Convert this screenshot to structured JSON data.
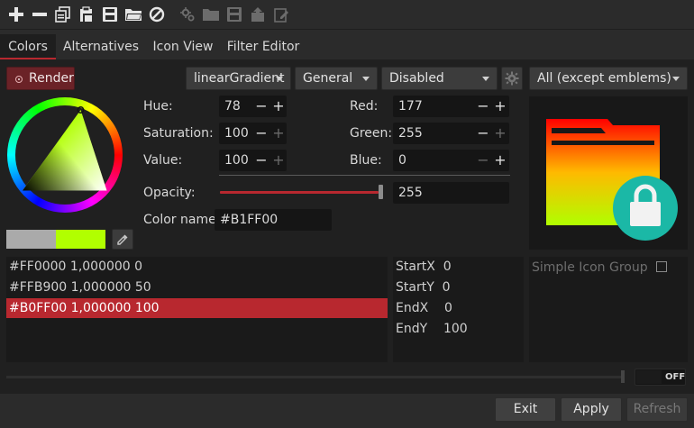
{
  "tabs": [
    {
      "label": "Colors",
      "active": true
    },
    {
      "label": "Alternatives"
    },
    {
      "label": "Icon View"
    },
    {
      "label": "Filter Editor"
    }
  ],
  "render_button": {
    "label": "Render"
  },
  "dropdowns": {
    "gradient_type": "linearGradient",
    "category": "General",
    "state": "Disabled",
    "scope": "All (except emblems)"
  },
  "hsv": {
    "hue_label": "Hue:",
    "hue": "78",
    "saturation_label": "Saturation:",
    "saturation": "100",
    "value_label": "Value:",
    "value": "100"
  },
  "rgb": {
    "red_label": "Red:",
    "red": "177",
    "green_label": "Green:",
    "green": "255",
    "blue_label": "Blue:",
    "blue": "0"
  },
  "opacity": {
    "label": "Opacity:",
    "value": "255",
    "fraction": 1.0
  },
  "color_name": {
    "label": "Color name:",
    "value": "#B1FF00"
  },
  "stops": [
    {
      "text": "#FF0000  1,000000 0",
      "selected": false
    },
    {
      "text": "#FFB900  1,000000 50",
      "selected": false
    },
    {
      "text": "#B0FF00  1,000000 100",
      "selected": true
    }
  ],
  "coords": [
    {
      "text": "StartX  0"
    },
    {
      "text": "StartY  0"
    },
    {
      "text": "EndX    0"
    },
    {
      "text": "EndY    100"
    }
  ],
  "group": {
    "label": "Simple Icon Group",
    "checked": false
  },
  "toggle": {
    "label": "OFF"
  },
  "buttons": {
    "exit": "Exit",
    "apply": "Apply",
    "refresh": "Refresh"
  },
  "colors": {
    "accent": "#b8282f",
    "current_color": "#b1ff00",
    "previous_color": "#aaaaaa",
    "lock_badge": "#1bb8a6"
  },
  "icons": {
    "toolbar": [
      "plus-icon",
      "minus-icon",
      "copy-icon",
      "paste-icon",
      "save-icon",
      "open-folder-icon",
      "block-icon",
      "settings-disabled-icon",
      "folder-disabled-icon",
      "save-disabled-icon",
      "export-disabled-icon",
      "edit-disabled-icon"
    ],
    "gear": "gear-icon",
    "picker": "eyedropper-icon"
  }
}
